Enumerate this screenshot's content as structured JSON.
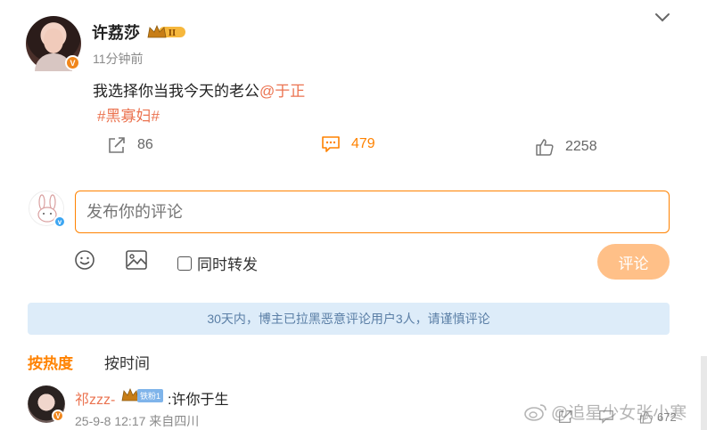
{
  "post": {
    "username": "许荔莎",
    "vip_level": "II",
    "time": "11分钟前",
    "content_text": "我选择你当我今天的老公",
    "mention": "@于正",
    "hashtag": "#黑寡妇#",
    "share_count": "86",
    "comment_count": "479",
    "like_count": "2258"
  },
  "composer": {
    "placeholder": "发布你的评论",
    "repost_label": "同时转发",
    "submit_label": "评论"
  },
  "notice": "30天内，博主已拉黑恶意评论用户3人，请谨慎评论",
  "sort": {
    "hot": "按热度",
    "time": "按时间"
  },
  "comments": [
    {
      "username": "祁zzz-",
      "fan_badge": "铁粉1",
      "text": ":许你于生",
      "meta": "25-9-8 12:17 来自四川",
      "like_count": "672"
    }
  ],
  "watermark": "@追星少女张小寒",
  "colors": {
    "accent": "#ff8200",
    "link": "#eb7350",
    "notice_bg": "#ddecf9",
    "submit_bg": "#ffc088"
  }
}
